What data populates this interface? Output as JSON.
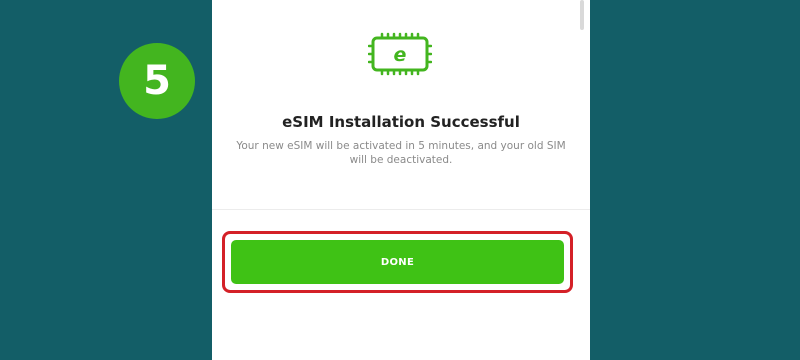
{
  "step": {
    "number": "5"
  },
  "icon": {
    "name": "esim-chip-icon",
    "letter": "e",
    "color": "#43b51f"
  },
  "success": {
    "title": "eSIM Installation Successful",
    "message": "Your new eSIM will be activated in 5 minutes, and your old SIM will be deactivated."
  },
  "actions": {
    "done_label": "DONE"
  },
  "colors": {
    "background": "#135e67",
    "accent_green": "#43b51f",
    "button_green": "#3fc215",
    "highlight_red": "#d42027"
  }
}
